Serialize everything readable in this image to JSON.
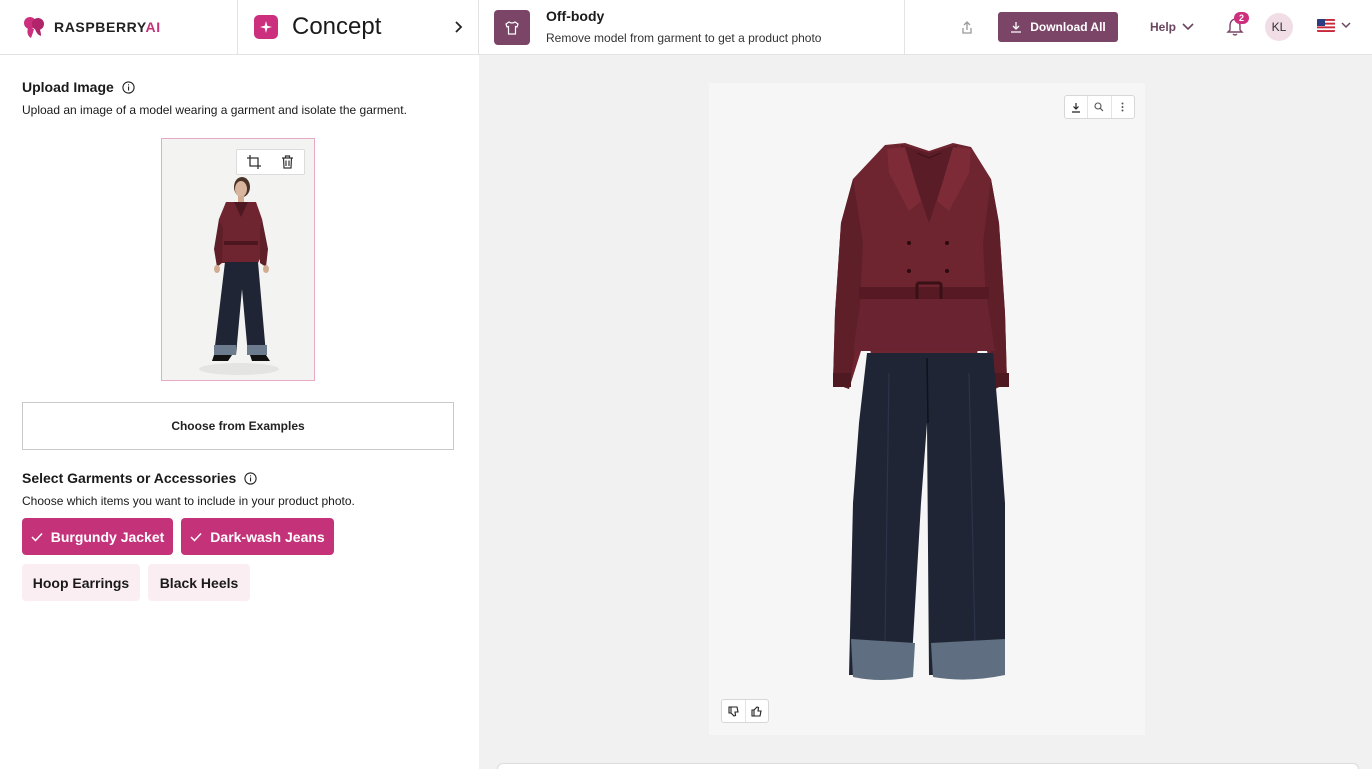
{
  "header": {
    "logo_text": "RASPBERRY",
    "logo_text_accent": "AI",
    "section_title": "Concept",
    "section_icon": "sparkle-icon",
    "tool_title": "Off-body",
    "tool_subtitle": "Remove model from garment to get a product photo",
    "tool_icon": "shirt-icon",
    "download_all_label": "Download All",
    "help_label": "Help",
    "notification_count": "2",
    "avatar_initials": "KL",
    "language_flag": "us-flag-icon"
  },
  "left_panel": {
    "upload": {
      "title": "Upload Image",
      "description": "Upload an image of a model wearing a garment and isolate the garment.",
      "thumbnail_alt": "Model wearing burgundy jacket and dark-wash jeans",
      "tools": [
        "crop-icon",
        "trash-icon"
      ]
    },
    "choose_examples_label": "Choose from Examples",
    "garments": {
      "title": "Select Garments or Accessories",
      "description": "Choose which items you want to include in your product photo.",
      "items": [
        {
          "label": "Burgundy Jacket",
          "selected": true
        },
        {
          "label": "Dark-wash Jeans",
          "selected": true
        },
        {
          "label": "Hoop Earrings",
          "selected": false
        },
        {
          "label": "Black Heels",
          "selected": false
        }
      ]
    }
  },
  "result": {
    "image_alt": "Off-body product photo of burgundy leather jacket and dark-wash wide-leg jeans",
    "toolbar_icons": [
      "download-icon",
      "zoom-icon",
      "more-icon"
    ],
    "rating_icons": [
      "thumbs-down-icon",
      "thumbs-up-icon"
    ]
  },
  "colors": {
    "brand_pink": "#c4337a",
    "brand_plum": "#7a4566",
    "chip_off_bg": "#fbeef3",
    "jacket": "#6e2530",
    "jeans": "#1f2535"
  }
}
